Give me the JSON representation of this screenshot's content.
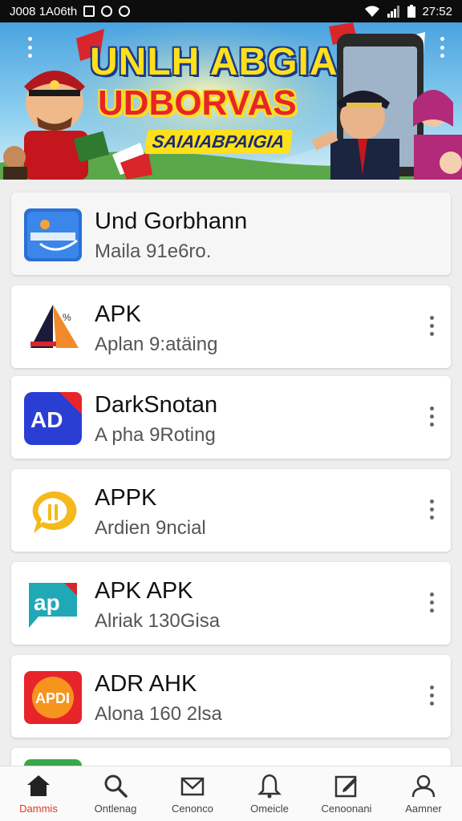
{
  "status_bar": {
    "left_text": "J008 1A06th",
    "time": "27:52"
  },
  "banner": {
    "title_line1": "UNLH ABGIA",
    "title_line2": "UDBORVAS",
    "subtitle": "SAIAIABPAIGIA"
  },
  "apps": [
    {
      "title": "Und Gorbhann",
      "subtitle": "Maila 91e6ro.",
      "icon": "blue-app-icon"
    },
    {
      "title": "APK",
      "subtitle": "Aplan 9:atäing",
      "icon": "sail-triangle-icon"
    },
    {
      "title": "DarkSnotan",
      "subtitle": "A pha 9Roting",
      "icon": "ad-badge-icon"
    },
    {
      "title": "APPK",
      "subtitle": "Ardien 9ncial",
      "icon": "chat-bubble-icon"
    },
    {
      "title": "APK APK",
      "subtitle": "Alriak 130Gisa",
      "icon": "ap-badge-icon"
    },
    {
      "title": "ADR AHK",
      "subtitle": "Alona 160 2lsa",
      "icon": "orange-app-icon"
    }
  ],
  "nav": [
    {
      "label": "Dammis",
      "icon": "home-icon"
    },
    {
      "label": "Ontlenag",
      "icon": "search-icon"
    },
    {
      "label": "Cenonco",
      "icon": "mail-icon"
    },
    {
      "label": "Omeicle",
      "icon": "bell-icon"
    },
    {
      "label": "Cenoonani",
      "icon": "edit-icon"
    },
    {
      "label": "Aamner",
      "icon": "profile-icon"
    }
  ],
  "colors": {
    "accent": "#e03a1e",
    "banner_yellow": "#ffe01a",
    "banner_red": "#e8242b",
    "banner_blue": "#1b2c6e"
  }
}
